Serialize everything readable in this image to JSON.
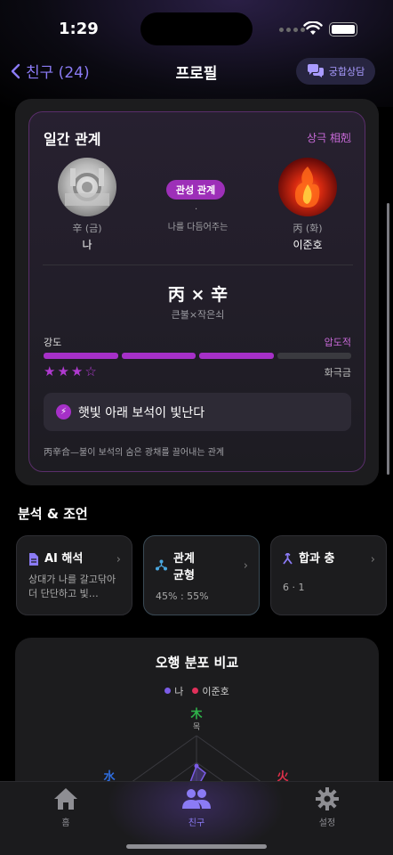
{
  "status": {
    "time": "1:29"
  },
  "nav": {
    "back_label": "친구 (24)",
    "title": "프로필",
    "consult_label": "궁합상담"
  },
  "relation": {
    "title": "일간 관계",
    "type": "상극 相剋",
    "me": {
      "element": "辛 (금)",
      "name": "나"
    },
    "friend": {
      "element": "丙 (화)",
      "name": "이준호"
    },
    "badge": "관성 관계",
    "dot": "·",
    "desc": "나를 다듬어주는",
    "combo": "丙 × 辛",
    "combo_sub": "큰불×작은쇠",
    "strength_label": "강도",
    "strength_value": "압도적",
    "strength_level": 3,
    "strength_max": 4,
    "stars": "★★★☆",
    "element_pair": "화극금",
    "metaphor": "햇빛 아래 보석이 빛난다",
    "footnote": "丙辛合—불이 보석의 숨은 광채를 끌어내는 관계"
  },
  "analysis": {
    "title": "분석 & 조언",
    "tiles": [
      {
        "title": "AI 해석",
        "body": "상대가 나를 갈고닦아 더 단단하고 빛…",
        "icon": "document-icon"
      },
      {
        "title": "관계 균형",
        "body": "45% : 55%",
        "icon": "share-nodes-icon"
      },
      {
        "title": "합과 충",
        "body": "6 · 1",
        "icon": "merge-icon"
      }
    ]
  },
  "ohaeng": {
    "title": "오행 분포 비교",
    "legend": [
      {
        "name": "나",
        "color": "#7b5ce6"
      },
      {
        "name": "이준호",
        "color": "#e0305a"
      }
    ],
    "labels": {
      "wood_char": "木",
      "wood": "목",
      "fire_char": "火",
      "water_char": "水"
    },
    "colors": {
      "wood": "#2fb34a",
      "fire": "#e0304a",
      "water": "#2f6ee0"
    }
  },
  "tabbar": {
    "home": "홈",
    "friends": "친구",
    "settings": "설정"
  },
  "theme": {
    "accent": "#8b7bf5",
    "purple": "#a630c8",
    "magenta": "#c86ad8"
  }
}
